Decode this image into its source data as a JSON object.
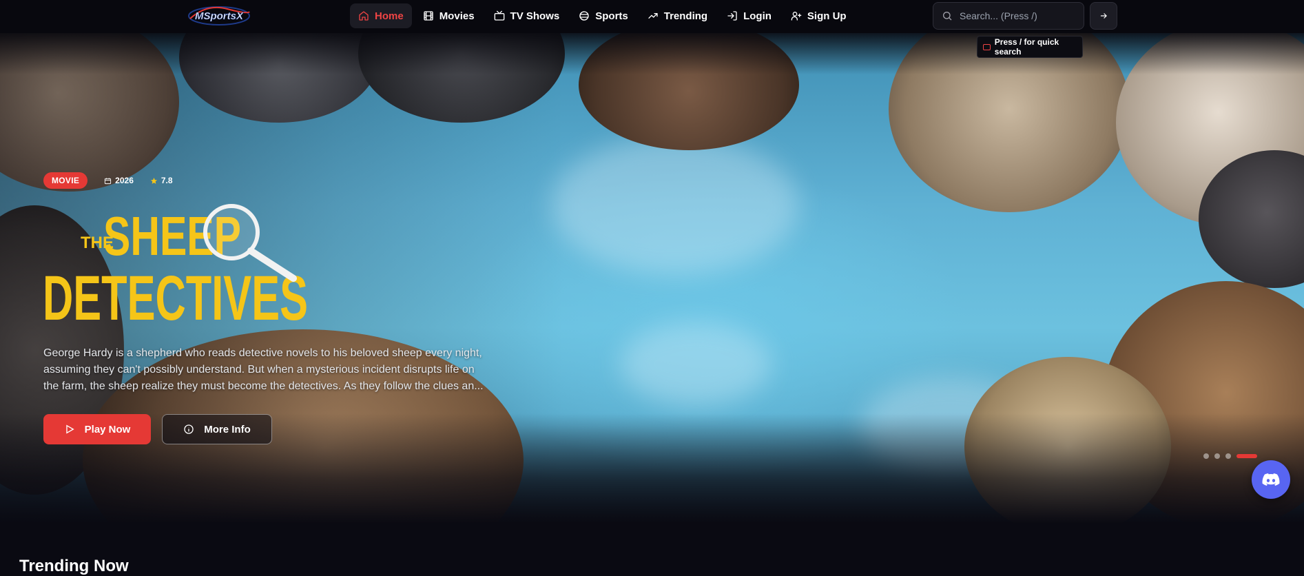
{
  "brand": {
    "logo_text": "MSportsX"
  },
  "nav": {
    "items": [
      {
        "label": "Home",
        "icon": "home-icon",
        "active": true
      },
      {
        "label": "Movies",
        "icon": "film-icon",
        "active": false
      },
      {
        "label": "TV Shows",
        "icon": "tv-icon",
        "active": false
      },
      {
        "label": "Sports",
        "icon": "ball-icon",
        "active": false
      },
      {
        "label": "Trending",
        "icon": "trending-icon",
        "active": false
      },
      {
        "label": "Login",
        "icon": "login-icon",
        "active": false
      },
      {
        "label": "Sign Up",
        "icon": "user-plus-icon",
        "active": false
      }
    ]
  },
  "search": {
    "placeholder": "Search... (Press /)",
    "value": "",
    "quick_hint": "Press / for quick search"
  },
  "hero": {
    "type_badge": "MOVIE",
    "year": "2026",
    "rating": "7.8",
    "title_logo": {
      "the": "THE",
      "line1": "SHEEP",
      "line2": "DETECTIVES"
    },
    "description": "George Hardy is a shepherd who reads detective novels to his beloved sheep every night, assuming they can't possibly understand. But when a mysterious incident disrupts life on the farm, the sheep realize they must become the detectives. As they follow the clues an...",
    "play_label": "Play Now",
    "info_label": "More Info",
    "slides_total": 4,
    "slide_active": 4
  },
  "colors": {
    "accent": "#e53935",
    "background": "#0a0a12",
    "title_yellow": "#f5c518",
    "discord": "#5865f2"
  },
  "section": {
    "heading": "Trending Now"
  }
}
